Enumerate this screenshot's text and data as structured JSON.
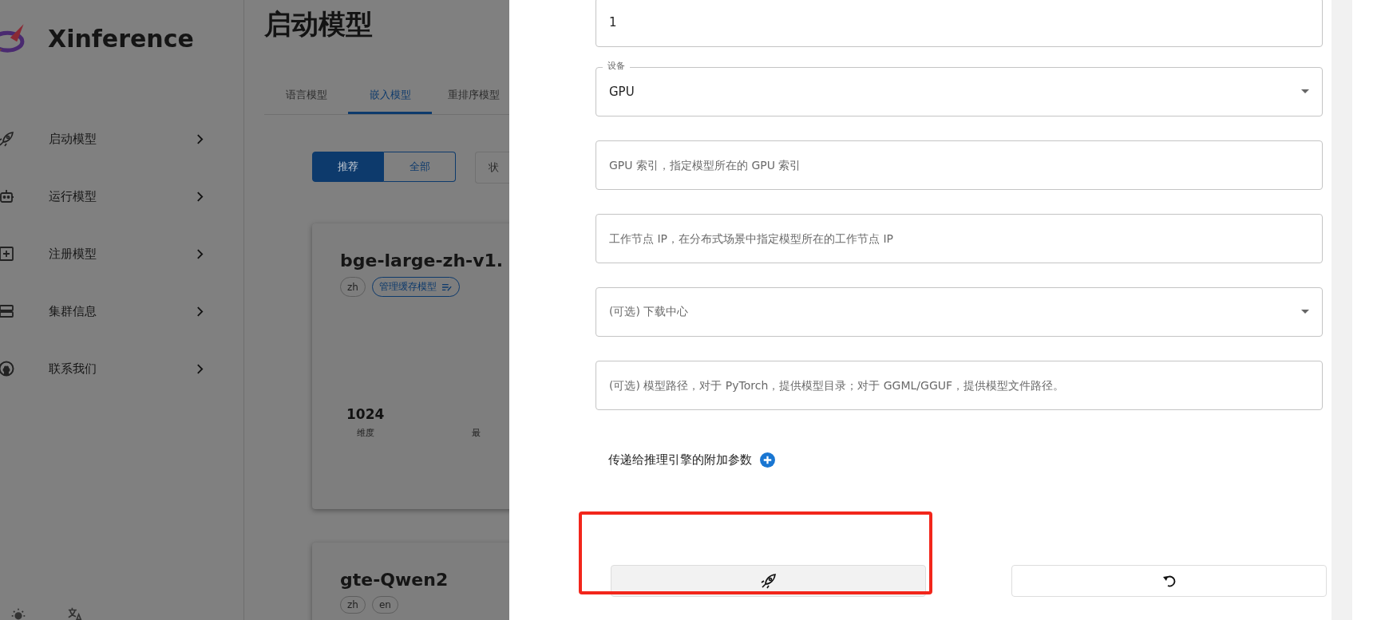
{
  "sidebar": {
    "brand": "Xinference",
    "items": [
      {
        "label": "启动模型"
      },
      {
        "label": "运行模型"
      },
      {
        "label": "注册模型"
      },
      {
        "label": "集群信息"
      },
      {
        "label": "联系我们"
      }
    ]
  },
  "page": {
    "title": "启动模型",
    "tabs": [
      {
        "label": "语言模型",
        "selected": false
      },
      {
        "label": "嵌入模型",
        "selected": true
      },
      {
        "label": "重排序模型",
        "selected": false
      }
    ],
    "filters": [
      {
        "label": "推荐",
        "selected": true
      },
      {
        "label": "全部",
        "selected": false
      }
    ],
    "status_field": "状",
    "cards": [
      {
        "name": "bge-large-zh-v1.",
        "tags": [
          {
            "label": "zh",
            "kind": "lang"
          },
          {
            "label": "管理缓存模型",
            "kind": "cache"
          }
        ],
        "stats": [
          {
            "value": "1024",
            "label": "维度"
          },
          {
            "label": "最"
          }
        ]
      },
      {
        "name": "gte-Qwen2",
        "tags": [
          {
            "label": "zh",
            "kind": "lang"
          },
          {
            "label": "en",
            "kind": "lang"
          }
        ]
      }
    ]
  },
  "drawer": {
    "fields": [
      {
        "kind": "text",
        "value": "1"
      },
      {
        "kind": "select",
        "label": "设备",
        "value": "GPU"
      },
      {
        "kind": "text",
        "placeholder": "GPU 索引，指定模型所在的 GPU 索引"
      },
      {
        "kind": "text",
        "placeholder": "工作节点 IP，在分布式场景中指定模型所在的工作节点 IP"
      },
      {
        "kind": "select",
        "placeholder": "(可选) 下载中心"
      },
      {
        "kind": "text",
        "placeholder": "(可选) 模型路径，对于 PyTorch，提供模型目录；对于 GGML/GGUF，提供模型文件路径。"
      }
    ],
    "extra_params": "传递给推理引擎的附加参数",
    "actions": [
      {
        "kind": "launch",
        "highlighted": true
      },
      {
        "kind": "reset",
        "highlighted": false
      }
    ]
  }
}
